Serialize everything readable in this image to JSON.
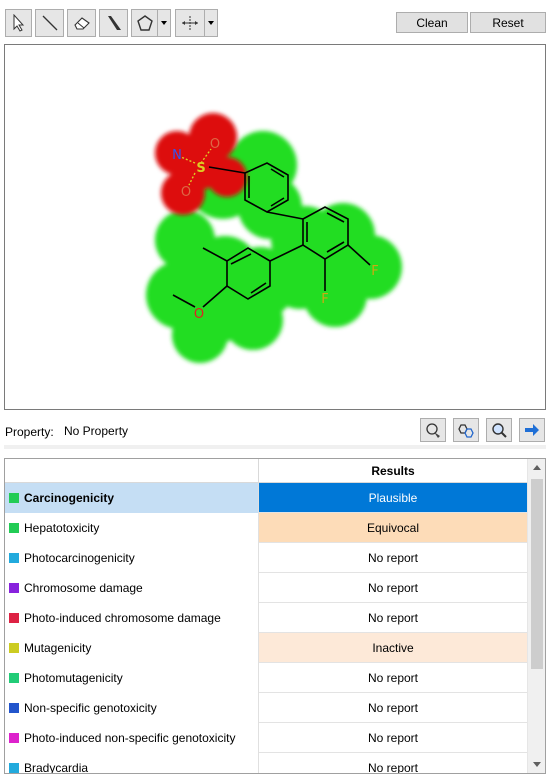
{
  "toolbar": {
    "tools": [
      "select-arrow-icon",
      "line-bond-icon",
      "eraser-icon",
      "wedge-bond-icon",
      "pentagon-ring-icon",
      "move-arrows-icon"
    ],
    "clean_label": "Clean",
    "reset_label": "Reset"
  },
  "molecule": {
    "atom_labels": {
      "n": "N",
      "s": "S",
      "o1": "O",
      "o2": "O",
      "f1": "F",
      "f2": "F",
      "o3": "O"
    },
    "colors": {
      "halo_green": "#22dd22",
      "halo_red": "#dd1111",
      "bond": "#000000",
      "n": "#3355ee",
      "s": "#ddcc22",
      "o": "#dd2222",
      "f": "#ccaa11"
    }
  },
  "property": {
    "label": "Property:",
    "value": "No Property",
    "icons": [
      "atom-mapping-icon",
      "ring-highlight-icon",
      "zoom-fit-icon",
      "next-arrow-icon"
    ]
  },
  "results": {
    "header": "Results",
    "rows": [
      {
        "name": "Carcinogenicity",
        "result": "Plausible",
        "color": "#22cc55",
        "selected": true,
        "res_bg": "#0078d7",
        "res_fg": "#ffffff"
      },
      {
        "name": "Hepatotoxicity",
        "result": "Equivocal",
        "color": "#22cc55",
        "selected": false,
        "res_bg": "#fddcb8",
        "res_fg": "#000000"
      },
      {
        "name": "Photocarcinogenicity",
        "result": "No report",
        "color": "#22aadd",
        "selected": false,
        "res_bg": "#ffffff",
        "res_fg": "#000000"
      },
      {
        "name": "Chromosome damage",
        "result": "No report",
        "color": "#8822dd",
        "selected": false,
        "res_bg": "#ffffff",
        "res_fg": "#000000"
      },
      {
        "name": "Photo-induced chromosome damage",
        "result": "No report",
        "color": "#dd2244",
        "selected": false,
        "res_bg": "#ffffff",
        "res_fg": "#000000"
      },
      {
        "name": "Mutagenicity",
        "result": "Inactive",
        "color": "#cccc22",
        "selected": false,
        "res_bg": "#fde9d8",
        "res_fg": "#000000"
      },
      {
        "name": "Photomutagenicity",
        "result": "No report",
        "color": "#22cc77",
        "selected": false,
        "res_bg": "#ffffff",
        "res_fg": "#000000"
      },
      {
        "name": "Non-specific genotoxicity",
        "result": "No report",
        "color": "#2255cc",
        "selected": false,
        "res_bg": "#ffffff",
        "res_fg": "#000000"
      },
      {
        "name": "Photo-induced non-specific genotoxicity",
        "result": "No report",
        "color": "#dd22cc",
        "selected": false,
        "res_bg": "#ffffff",
        "res_fg": "#000000"
      },
      {
        "name": "Bradycardia",
        "result": "No report",
        "color": "#22aadd",
        "selected": false,
        "res_bg": "#ffffff",
        "res_fg": "#000000"
      }
    ]
  }
}
